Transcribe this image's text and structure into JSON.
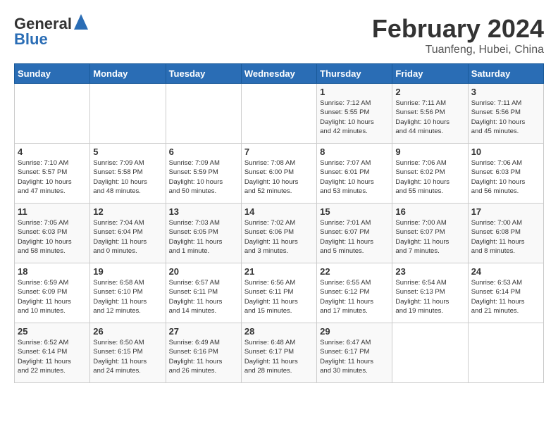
{
  "logo": {
    "line1": "General",
    "line2": "Blue"
  },
  "title": "February 2024",
  "subtitle": "Tuanfeng, Hubei, China",
  "weekdays": [
    "Sunday",
    "Monday",
    "Tuesday",
    "Wednesday",
    "Thursday",
    "Friday",
    "Saturday"
  ],
  "weeks": [
    [
      {
        "day": "",
        "info": ""
      },
      {
        "day": "",
        "info": ""
      },
      {
        "day": "",
        "info": ""
      },
      {
        "day": "",
        "info": ""
      },
      {
        "day": "1",
        "info": "Sunrise: 7:12 AM\nSunset: 5:55 PM\nDaylight: 10 hours\nand 42 minutes."
      },
      {
        "day": "2",
        "info": "Sunrise: 7:11 AM\nSunset: 5:56 PM\nDaylight: 10 hours\nand 44 minutes."
      },
      {
        "day": "3",
        "info": "Sunrise: 7:11 AM\nSunset: 5:56 PM\nDaylight: 10 hours\nand 45 minutes."
      }
    ],
    [
      {
        "day": "4",
        "info": "Sunrise: 7:10 AM\nSunset: 5:57 PM\nDaylight: 10 hours\nand 47 minutes."
      },
      {
        "day": "5",
        "info": "Sunrise: 7:09 AM\nSunset: 5:58 PM\nDaylight: 10 hours\nand 48 minutes."
      },
      {
        "day": "6",
        "info": "Sunrise: 7:09 AM\nSunset: 5:59 PM\nDaylight: 10 hours\nand 50 minutes."
      },
      {
        "day": "7",
        "info": "Sunrise: 7:08 AM\nSunset: 6:00 PM\nDaylight: 10 hours\nand 52 minutes."
      },
      {
        "day": "8",
        "info": "Sunrise: 7:07 AM\nSunset: 6:01 PM\nDaylight: 10 hours\nand 53 minutes."
      },
      {
        "day": "9",
        "info": "Sunrise: 7:06 AM\nSunset: 6:02 PM\nDaylight: 10 hours\nand 55 minutes."
      },
      {
        "day": "10",
        "info": "Sunrise: 7:06 AM\nSunset: 6:03 PM\nDaylight: 10 hours\nand 56 minutes."
      }
    ],
    [
      {
        "day": "11",
        "info": "Sunrise: 7:05 AM\nSunset: 6:03 PM\nDaylight: 10 hours\nand 58 minutes."
      },
      {
        "day": "12",
        "info": "Sunrise: 7:04 AM\nSunset: 6:04 PM\nDaylight: 11 hours\nand 0 minutes."
      },
      {
        "day": "13",
        "info": "Sunrise: 7:03 AM\nSunset: 6:05 PM\nDaylight: 11 hours\nand 1 minute."
      },
      {
        "day": "14",
        "info": "Sunrise: 7:02 AM\nSunset: 6:06 PM\nDaylight: 11 hours\nand 3 minutes."
      },
      {
        "day": "15",
        "info": "Sunrise: 7:01 AM\nSunset: 6:07 PM\nDaylight: 11 hours\nand 5 minutes."
      },
      {
        "day": "16",
        "info": "Sunrise: 7:00 AM\nSunset: 6:07 PM\nDaylight: 11 hours\nand 7 minutes."
      },
      {
        "day": "17",
        "info": "Sunrise: 7:00 AM\nSunset: 6:08 PM\nDaylight: 11 hours\nand 8 minutes."
      }
    ],
    [
      {
        "day": "18",
        "info": "Sunrise: 6:59 AM\nSunset: 6:09 PM\nDaylight: 11 hours\nand 10 minutes."
      },
      {
        "day": "19",
        "info": "Sunrise: 6:58 AM\nSunset: 6:10 PM\nDaylight: 11 hours\nand 12 minutes."
      },
      {
        "day": "20",
        "info": "Sunrise: 6:57 AM\nSunset: 6:11 PM\nDaylight: 11 hours\nand 14 minutes."
      },
      {
        "day": "21",
        "info": "Sunrise: 6:56 AM\nSunset: 6:11 PM\nDaylight: 11 hours\nand 15 minutes."
      },
      {
        "day": "22",
        "info": "Sunrise: 6:55 AM\nSunset: 6:12 PM\nDaylight: 11 hours\nand 17 minutes."
      },
      {
        "day": "23",
        "info": "Sunrise: 6:54 AM\nSunset: 6:13 PM\nDaylight: 11 hours\nand 19 minutes."
      },
      {
        "day": "24",
        "info": "Sunrise: 6:53 AM\nSunset: 6:14 PM\nDaylight: 11 hours\nand 21 minutes."
      }
    ],
    [
      {
        "day": "25",
        "info": "Sunrise: 6:52 AM\nSunset: 6:14 PM\nDaylight: 11 hours\nand 22 minutes."
      },
      {
        "day": "26",
        "info": "Sunrise: 6:50 AM\nSunset: 6:15 PM\nDaylight: 11 hours\nand 24 minutes."
      },
      {
        "day": "27",
        "info": "Sunrise: 6:49 AM\nSunset: 6:16 PM\nDaylight: 11 hours\nand 26 minutes."
      },
      {
        "day": "28",
        "info": "Sunrise: 6:48 AM\nSunset: 6:17 PM\nDaylight: 11 hours\nand 28 minutes."
      },
      {
        "day": "29",
        "info": "Sunrise: 6:47 AM\nSunset: 6:17 PM\nDaylight: 11 hours\nand 30 minutes."
      },
      {
        "day": "",
        "info": ""
      },
      {
        "day": "",
        "info": ""
      }
    ]
  ]
}
